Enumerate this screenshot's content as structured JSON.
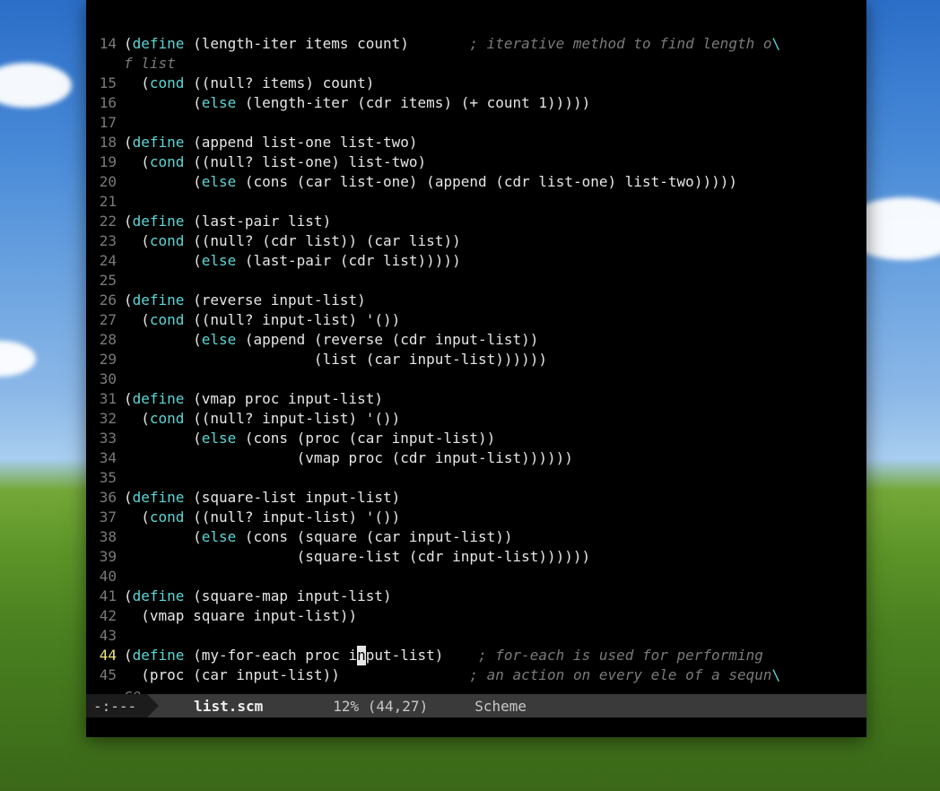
{
  "modeline": {
    "status": "-:---",
    "filename": "list.scm",
    "position": "12% (44,27)",
    "mode": "Scheme"
  },
  "cursor": {
    "line": 44,
    "col": 27
  },
  "lines": [
    {
      "n": 14,
      "tokens": [
        {
          "t": "p",
          "v": "("
        },
        {
          "t": "kw",
          "v": "define"
        },
        {
          "t": "p",
          "v": " ("
        },
        {
          "t": "txt",
          "v": "length-iter items count"
        },
        {
          "t": "p",
          "v": ")       "
        },
        {
          "t": "c",
          "v": "; iterative method to find length o"
        },
        {
          "t": "bs",
          "v": "\\"
        }
      ],
      "wrap": [
        {
          "t": "c",
          "v": "f list"
        }
      ]
    },
    {
      "n": 15,
      "tokens": [
        {
          "t": "p",
          "v": "  ("
        },
        {
          "t": "kw",
          "v": "cond"
        },
        {
          "t": "p",
          "v": " (("
        },
        {
          "t": "txt",
          "v": "null? items"
        },
        {
          "t": "p",
          "v": ") "
        },
        {
          "t": "txt",
          "v": "count"
        },
        {
          "t": "p",
          "v": ")"
        }
      ]
    },
    {
      "n": 16,
      "tokens": [
        {
          "t": "p",
          "v": "        ("
        },
        {
          "t": "kw",
          "v": "else"
        },
        {
          "t": "p",
          "v": " ("
        },
        {
          "t": "txt",
          "v": "length-iter "
        },
        {
          "t": "p",
          "v": "("
        },
        {
          "t": "txt",
          "v": "cdr items"
        },
        {
          "t": "p",
          "v": ") ("
        },
        {
          "t": "txt",
          "v": "+ count 1"
        },
        {
          "t": "p",
          "v": ")))))"
        }
      ]
    },
    {
      "n": 17,
      "tokens": []
    },
    {
      "n": 18,
      "tokens": [
        {
          "t": "p",
          "v": "("
        },
        {
          "t": "kw",
          "v": "define"
        },
        {
          "t": "p",
          "v": " ("
        },
        {
          "t": "txt",
          "v": "append list-one list-two"
        },
        {
          "t": "p",
          "v": ")"
        }
      ]
    },
    {
      "n": 19,
      "tokens": [
        {
          "t": "p",
          "v": "  ("
        },
        {
          "t": "kw",
          "v": "cond"
        },
        {
          "t": "p",
          "v": " (("
        },
        {
          "t": "txt",
          "v": "null? list-one"
        },
        {
          "t": "p",
          "v": ") "
        },
        {
          "t": "txt",
          "v": "list-two"
        },
        {
          "t": "p",
          "v": ")"
        }
      ]
    },
    {
      "n": 20,
      "tokens": [
        {
          "t": "p",
          "v": "        ("
        },
        {
          "t": "kw",
          "v": "else"
        },
        {
          "t": "p",
          "v": " ("
        },
        {
          "t": "txt",
          "v": "cons "
        },
        {
          "t": "p",
          "v": "("
        },
        {
          "t": "txt",
          "v": "car list-one"
        },
        {
          "t": "p",
          "v": ") ("
        },
        {
          "t": "txt",
          "v": "append "
        },
        {
          "t": "p",
          "v": "("
        },
        {
          "t": "txt",
          "v": "cdr list-one"
        },
        {
          "t": "p",
          "v": ") "
        },
        {
          "t": "txt",
          "v": "list-two"
        },
        {
          "t": "p",
          "v": ")))))"
        }
      ]
    },
    {
      "n": 21,
      "tokens": []
    },
    {
      "n": 22,
      "tokens": [
        {
          "t": "p",
          "v": "("
        },
        {
          "t": "kw",
          "v": "define"
        },
        {
          "t": "p",
          "v": " ("
        },
        {
          "t": "txt",
          "v": "last-pair list"
        },
        {
          "t": "p",
          "v": ")"
        }
      ]
    },
    {
      "n": 23,
      "tokens": [
        {
          "t": "p",
          "v": "  ("
        },
        {
          "t": "kw",
          "v": "cond"
        },
        {
          "t": "p",
          "v": " (("
        },
        {
          "t": "txt",
          "v": "null? "
        },
        {
          "t": "p",
          "v": "("
        },
        {
          "t": "txt",
          "v": "cdr list"
        },
        {
          "t": "p",
          "v": ")) ("
        },
        {
          "t": "txt",
          "v": "car list"
        },
        {
          "t": "p",
          "v": "))"
        }
      ]
    },
    {
      "n": 24,
      "tokens": [
        {
          "t": "p",
          "v": "        ("
        },
        {
          "t": "kw",
          "v": "else"
        },
        {
          "t": "p",
          "v": " ("
        },
        {
          "t": "txt",
          "v": "last-pair "
        },
        {
          "t": "p",
          "v": "("
        },
        {
          "t": "txt",
          "v": "cdr list"
        },
        {
          "t": "p",
          "v": ")))))"
        }
      ]
    },
    {
      "n": 25,
      "tokens": []
    },
    {
      "n": 26,
      "tokens": [
        {
          "t": "p",
          "v": "("
        },
        {
          "t": "kw",
          "v": "define"
        },
        {
          "t": "p",
          "v": " ("
        },
        {
          "t": "txt",
          "v": "reverse input-list"
        },
        {
          "t": "p",
          "v": ")"
        }
      ]
    },
    {
      "n": 27,
      "tokens": [
        {
          "t": "p",
          "v": "  ("
        },
        {
          "t": "kw",
          "v": "cond"
        },
        {
          "t": "p",
          "v": " (("
        },
        {
          "t": "txt",
          "v": "null? input-list"
        },
        {
          "t": "p",
          "v": ") '())"
        }
      ]
    },
    {
      "n": 28,
      "tokens": [
        {
          "t": "p",
          "v": "        ("
        },
        {
          "t": "kw",
          "v": "else"
        },
        {
          "t": "p",
          "v": " ("
        },
        {
          "t": "txt",
          "v": "append "
        },
        {
          "t": "p",
          "v": "("
        },
        {
          "t": "txt",
          "v": "reverse "
        },
        {
          "t": "p",
          "v": "("
        },
        {
          "t": "txt",
          "v": "cdr input-list"
        },
        {
          "t": "p",
          "v": "))"
        }
      ]
    },
    {
      "n": 29,
      "tokens": [
        {
          "t": "p",
          "v": "                      ("
        },
        {
          "t": "txt",
          "v": "list "
        },
        {
          "t": "p",
          "v": "("
        },
        {
          "t": "txt",
          "v": "car input-list"
        },
        {
          "t": "p",
          "v": "))))))"
        }
      ]
    },
    {
      "n": 30,
      "tokens": []
    },
    {
      "n": 31,
      "tokens": [
        {
          "t": "p",
          "v": "("
        },
        {
          "t": "kw",
          "v": "define"
        },
        {
          "t": "p",
          "v": " ("
        },
        {
          "t": "txt",
          "v": "vmap proc input-list"
        },
        {
          "t": "p",
          "v": ")"
        }
      ]
    },
    {
      "n": 32,
      "tokens": [
        {
          "t": "p",
          "v": "  ("
        },
        {
          "t": "kw",
          "v": "cond"
        },
        {
          "t": "p",
          "v": " (("
        },
        {
          "t": "txt",
          "v": "null? input-list"
        },
        {
          "t": "p",
          "v": ") '())"
        }
      ]
    },
    {
      "n": 33,
      "tokens": [
        {
          "t": "p",
          "v": "        ("
        },
        {
          "t": "kw",
          "v": "else"
        },
        {
          "t": "p",
          "v": " ("
        },
        {
          "t": "txt",
          "v": "cons "
        },
        {
          "t": "p",
          "v": "("
        },
        {
          "t": "txt",
          "v": "proc "
        },
        {
          "t": "p",
          "v": "("
        },
        {
          "t": "txt",
          "v": "car input-list"
        },
        {
          "t": "p",
          "v": "))"
        }
      ]
    },
    {
      "n": 34,
      "tokens": [
        {
          "t": "p",
          "v": "                    ("
        },
        {
          "t": "txt",
          "v": "vmap proc "
        },
        {
          "t": "p",
          "v": "("
        },
        {
          "t": "txt",
          "v": "cdr input-list"
        },
        {
          "t": "p",
          "v": "))))))"
        }
      ]
    },
    {
      "n": 35,
      "tokens": []
    },
    {
      "n": 36,
      "tokens": [
        {
          "t": "p",
          "v": "("
        },
        {
          "t": "kw",
          "v": "define"
        },
        {
          "t": "p",
          "v": " ("
        },
        {
          "t": "txt",
          "v": "square-list input-list"
        },
        {
          "t": "p",
          "v": ")"
        }
      ]
    },
    {
      "n": 37,
      "tokens": [
        {
          "t": "p",
          "v": "  ("
        },
        {
          "t": "kw",
          "v": "cond"
        },
        {
          "t": "p",
          "v": " (("
        },
        {
          "t": "txt",
          "v": "null? input-list"
        },
        {
          "t": "p",
          "v": ") '())"
        }
      ]
    },
    {
      "n": 38,
      "tokens": [
        {
          "t": "p",
          "v": "        ("
        },
        {
          "t": "kw",
          "v": "else"
        },
        {
          "t": "p",
          "v": " ("
        },
        {
          "t": "txt",
          "v": "cons "
        },
        {
          "t": "p",
          "v": "("
        },
        {
          "t": "txt",
          "v": "square "
        },
        {
          "t": "p",
          "v": "("
        },
        {
          "t": "txt",
          "v": "car input-list"
        },
        {
          "t": "p",
          "v": "))"
        }
      ]
    },
    {
      "n": 39,
      "tokens": [
        {
          "t": "p",
          "v": "                    ("
        },
        {
          "t": "txt",
          "v": "square-list "
        },
        {
          "t": "p",
          "v": "("
        },
        {
          "t": "txt",
          "v": "cdr input-list"
        },
        {
          "t": "p",
          "v": "))))))"
        }
      ]
    },
    {
      "n": 40,
      "tokens": []
    },
    {
      "n": 41,
      "tokens": [
        {
          "t": "p",
          "v": "("
        },
        {
          "t": "kw",
          "v": "define"
        },
        {
          "t": "p",
          "v": " ("
        },
        {
          "t": "txt",
          "v": "square-map input-list"
        },
        {
          "t": "p",
          "v": ")"
        }
      ]
    },
    {
      "n": 42,
      "tokens": [
        {
          "t": "p",
          "v": "  ("
        },
        {
          "t": "txt",
          "v": "vmap square input-list"
        },
        {
          "t": "p",
          "v": "))"
        }
      ]
    },
    {
      "n": 43,
      "tokens": []
    },
    {
      "n": 44,
      "current": true,
      "tokens": [
        {
          "t": "p",
          "v": "("
        },
        {
          "t": "kw",
          "v": "define"
        },
        {
          "t": "p",
          "v": " ("
        },
        {
          "t": "txt",
          "v": "my-for-each proc i"
        },
        {
          "t": "cur",
          "v": "n"
        },
        {
          "t": "txt",
          "v": "put-list"
        },
        {
          "t": "p",
          "v": ")    "
        },
        {
          "t": "c",
          "v": "; for-each is used for performing"
        }
      ]
    },
    {
      "n": 45,
      "tokens": [
        {
          "t": "p",
          "v": "  ("
        },
        {
          "t": "txt",
          "v": "proc "
        },
        {
          "t": "p",
          "v": "("
        },
        {
          "t": "txt",
          "v": "car input-list"
        },
        {
          "t": "p",
          "v": "))               "
        },
        {
          "t": "c",
          "v": "; an action on every ele of a sequn"
        },
        {
          "t": "bs",
          "v": "\\"
        }
      ],
      "wrap": [
        {
          "t": "c",
          "v": "ce"
        }
      ]
    }
  ]
}
